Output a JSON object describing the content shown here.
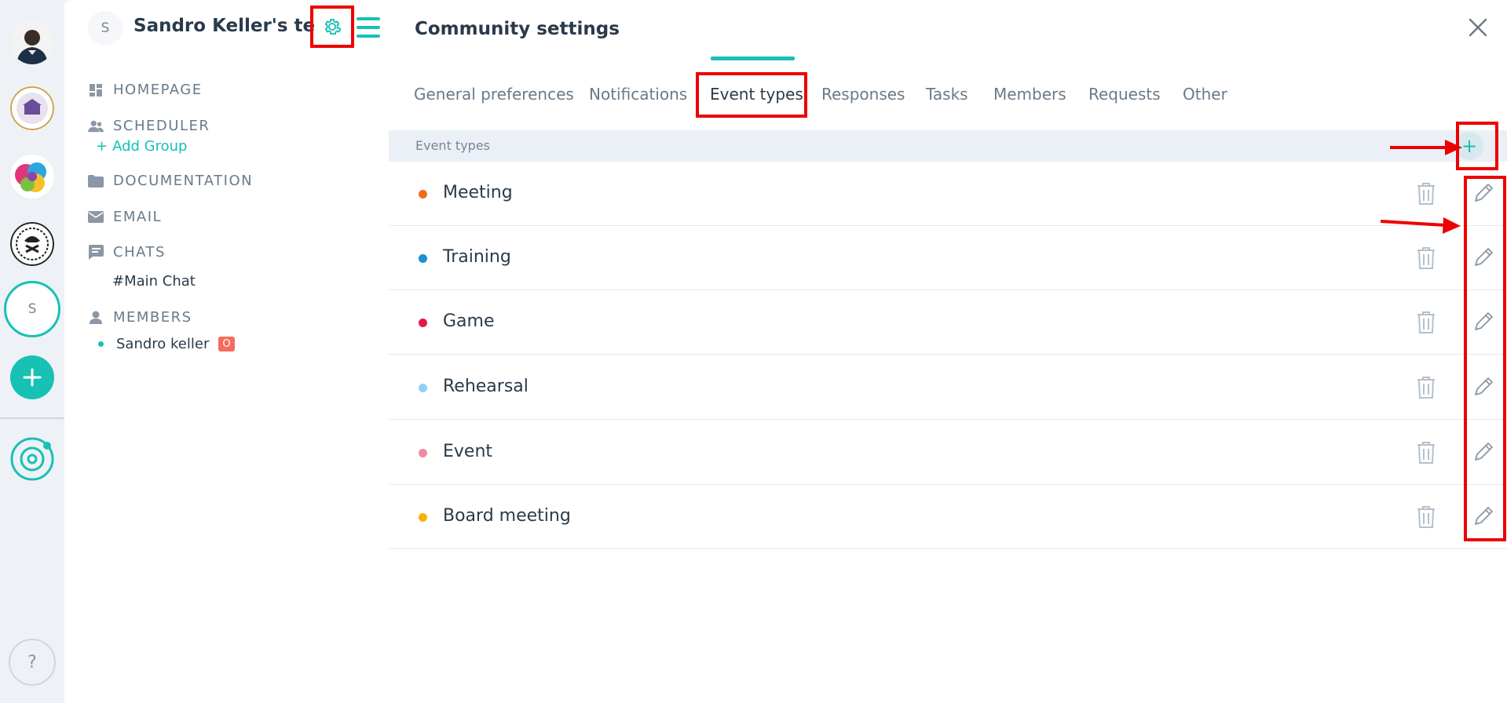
{
  "sidebar": {
    "team_initial": "S",
    "team_name": "Sandro Keller's te...",
    "nav": {
      "homepage": "HOMEPAGE",
      "scheduler": "SCHEDULER",
      "add_group": "Add Group",
      "documentation": "DOCUMENTATION",
      "email": "EMAIL",
      "chats": "CHATS",
      "main_chat": "#Main Chat",
      "members": "MEMBERS",
      "member_name": "Sandro keller",
      "member_badge": "O"
    }
  },
  "rail": {
    "community_initial": "S",
    "help": "?"
  },
  "settings": {
    "title": "Community settings",
    "tabs": [
      {
        "label": "General preferences"
      },
      {
        "label": "Notifications"
      },
      {
        "label": "Event types"
      },
      {
        "label": "Responses"
      },
      {
        "label": "Tasks"
      },
      {
        "label": "Members"
      },
      {
        "label": "Requests"
      },
      {
        "label": "Other"
      }
    ],
    "active_tab": "Event types",
    "section_label": "Event types",
    "event_types": [
      {
        "name": "Meeting",
        "color": "#f26b1d"
      },
      {
        "name": "Training",
        "color": "#1e8fd6"
      },
      {
        "name": "Game",
        "color": "#e3194b"
      },
      {
        "name": "Rehearsal",
        "color": "#8fd0f5"
      },
      {
        "name": "Event",
        "color": "#f28aa5"
      },
      {
        "name": "Board meeting",
        "color": "#f5b400"
      }
    ]
  },
  "colors": {
    "accent": "#17c1b4",
    "annotation": "#e00000"
  }
}
